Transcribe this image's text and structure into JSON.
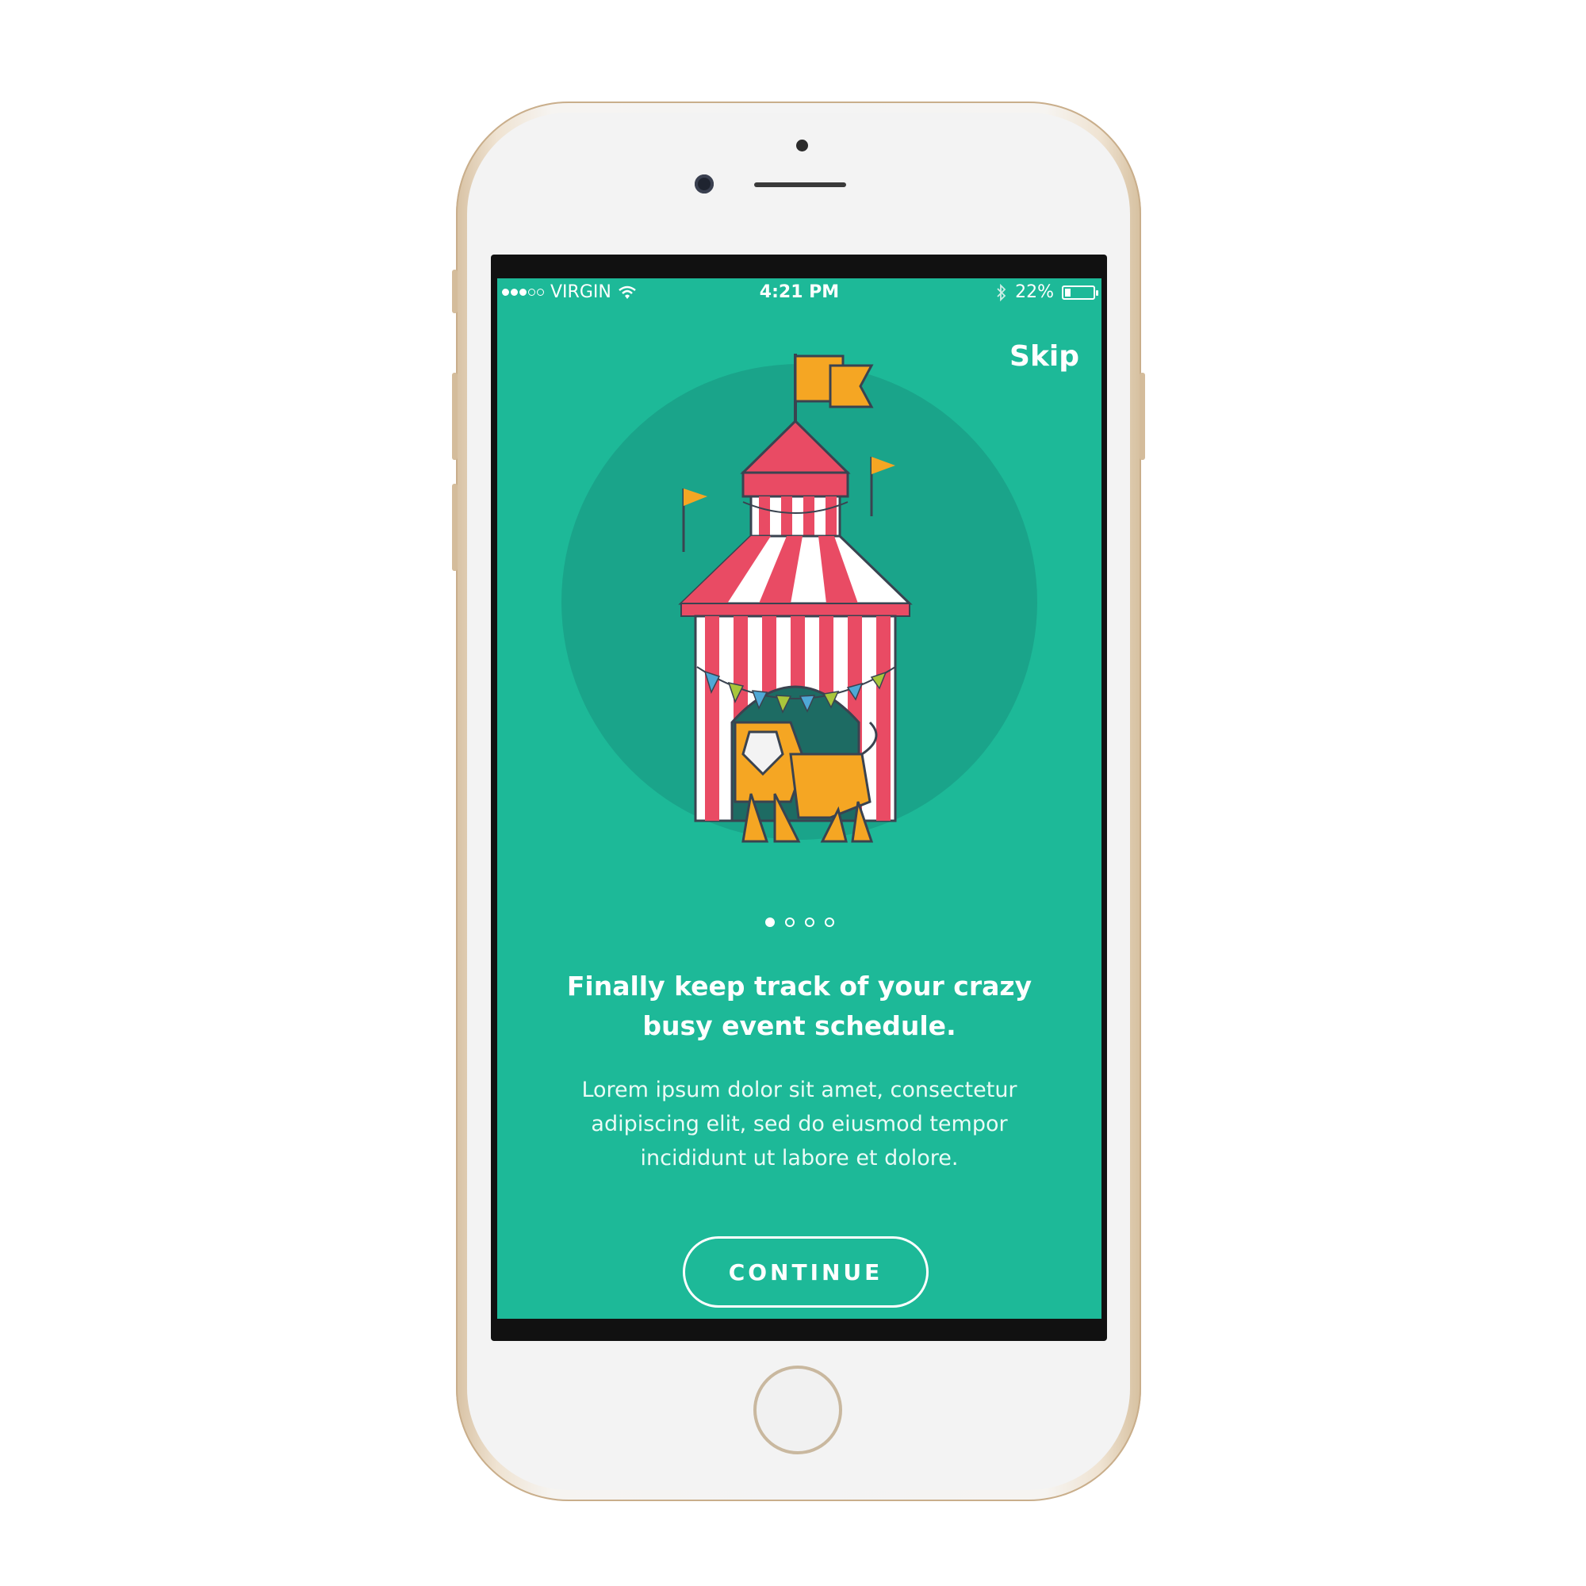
{
  "status_bar": {
    "carrier": "VIRGIN",
    "time": "4:21 PM",
    "battery_text": "22%",
    "battery_level": 0.22
  },
  "skip_label": "Skip",
  "pager": {
    "count": 4,
    "active_index": 0
  },
  "headline": "Finally keep track of your crazy busy event schedule.",
  "body": "Lorem ipsum dolor sit amet, consectetur adipiscing elit, sed do eiusmod tempor incididunt ut labore et dolore.",
  "continue_label": "CONTINUE",
  "colors": {
    "background": "#1db998",
    "tent_red": "#e94b64",
    "tent_white": "#ffffff",
    "flag_orange": "#f5a623",
    "lion": "#f5a623",
    "outline": "#3a4350"
  },
  "icons": [
    "wifi-icon",
    "bluetooth-icon",
    "battery-icon",
    "circus-tent-illustration",
    "lion-illustration"
  ]
}
